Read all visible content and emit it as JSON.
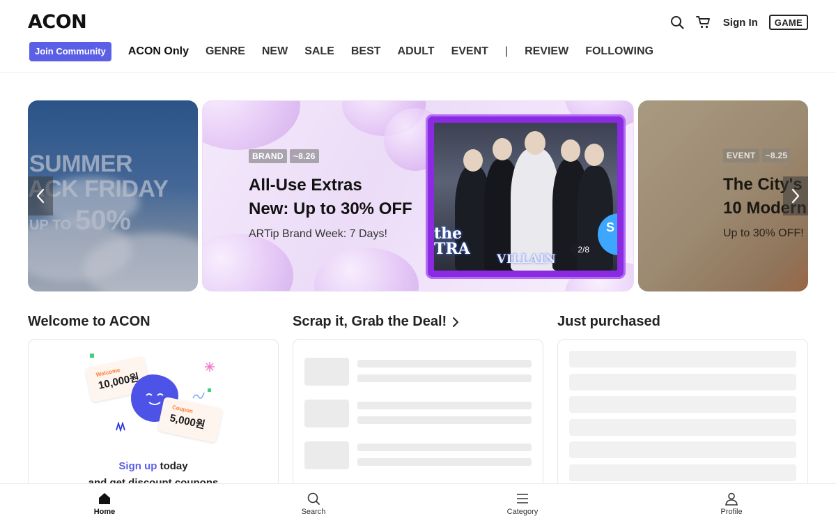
{
  "header": {
    "logo": "ACON",
    "sign_in": "Sign In",
    "game": "GAME"
  },
  "nav": {
    "join": "Join Community",
    "items": [
      "ACON Only",
      "GENRE",
      "NEW",
      "SALE",
      "BEST",
      "ADULT",
      "EVENT"
    ],
    "separator": "|",
    "items2": [
      "REVIEW",
      "FOLLOWING"
    ]
  },
  "carousel": {
    "left": {
      "line1": "SUMMER",
      "line2": "ACK FRIDAY",
      "line3_prefix": "UP TO",
      "line3_value": "50%"
    },
    "main": {
      "tag1": "BRAND",
      "tag2": "~8.26",
      "title_line1": "All-Use Extras",
      "title_line2": "New: Up to 30% OFF",
      "subtitle": "ARTip Brand Week: 7 Days!",
      "art_title": "VILLAIN",
      "art_left": "the\nTRA",
      "art_right": "S",
      "counter": "2/8"
    },
    "right": {
      "tag1": "EVENT",
      "tag2": "~8.25",
      "title_line1": "The City's",
      "title_line2": "10 Modern",
      "subtitle": "Up to 30% OFF!"
    }
  },
  "sections": {
    "welcome": {
      "title": "Welcome to ACON",
      "coupon1_label": "Welcome",
      "coupon1_value": "10,000원",
      "coupon2_label": "Coupon",
      "coupon2_value": "5,000원",
      "signup": "Sign up",
      "today": " today",
      "line2": "and get discount coupons"
    },
    "scrap": {
      "title": "Scrap it, Grab the Deal!"
    },
    "purchased": {
      "title": "Just purchased"
    }
  },
  "bottom_nav": {
    "home": "Home",
    "search": "Search",
    "category": "Category",
    "profile": "Profile"
  },
  "colors": {
    "accent": "#5a5fe6",
    "banner_frame": "#8a2be2"
  }
}
